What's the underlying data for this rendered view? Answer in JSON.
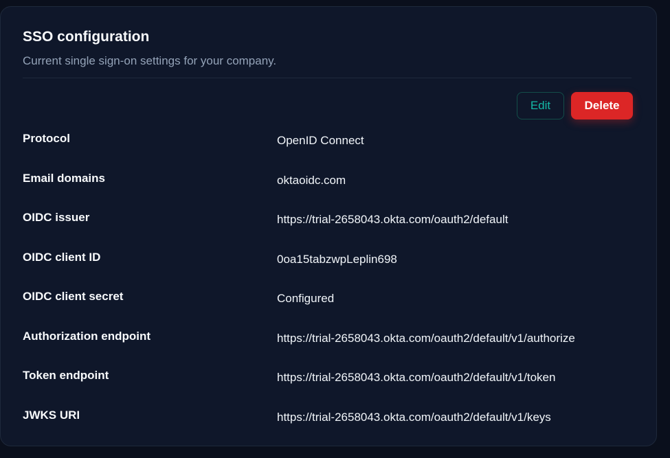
{
  "card": {
    "title": "SSO configuration",
    "subtitle": "Current single sign-on settings for your company."
  },
  "actions": {
    "edit_label": "Edit",
    "delete_label": "Delete"
  },
  "colors": {
    "background": "#0a0f1c",
    "card": "#0f172a",
    "accent": "#14b8a6",
    "danger": "#dc2626",
    "muted": "#94a3b8"
  },
  "fields": [
    {
      "label": "Protocol",
      "value": "OpenID Connect"
    },
    {
      "label": "Email domains",
      "value": "oktaoidc.com"
    },
    {
      "label": "OIDC issuer",
      "value": "https://trial-2658043.okta.com/oauth2/default"
    },
    {
      "label": "OIDC client ID",
      "value": "0oa15tabzwpLeplin698"
    },
    {
      "label": "OIDC client secret",
      "value": "Configured"
    },
    {
      "label": "Authorization endpoint",
      "value": "https://trial-2658043.okta.com/oauth2/default/v1/authorize"
    },
    {
      "label": "Token endpoint",
      "value": "https://trial-2658043.okta.com/oauth2/default/v1/token"
    },
    {
      "label": "JWKS URI",
      "value": "https://trial-2658043.okta.com/oauth2/default/v1/keys"
    }
  ]
}
